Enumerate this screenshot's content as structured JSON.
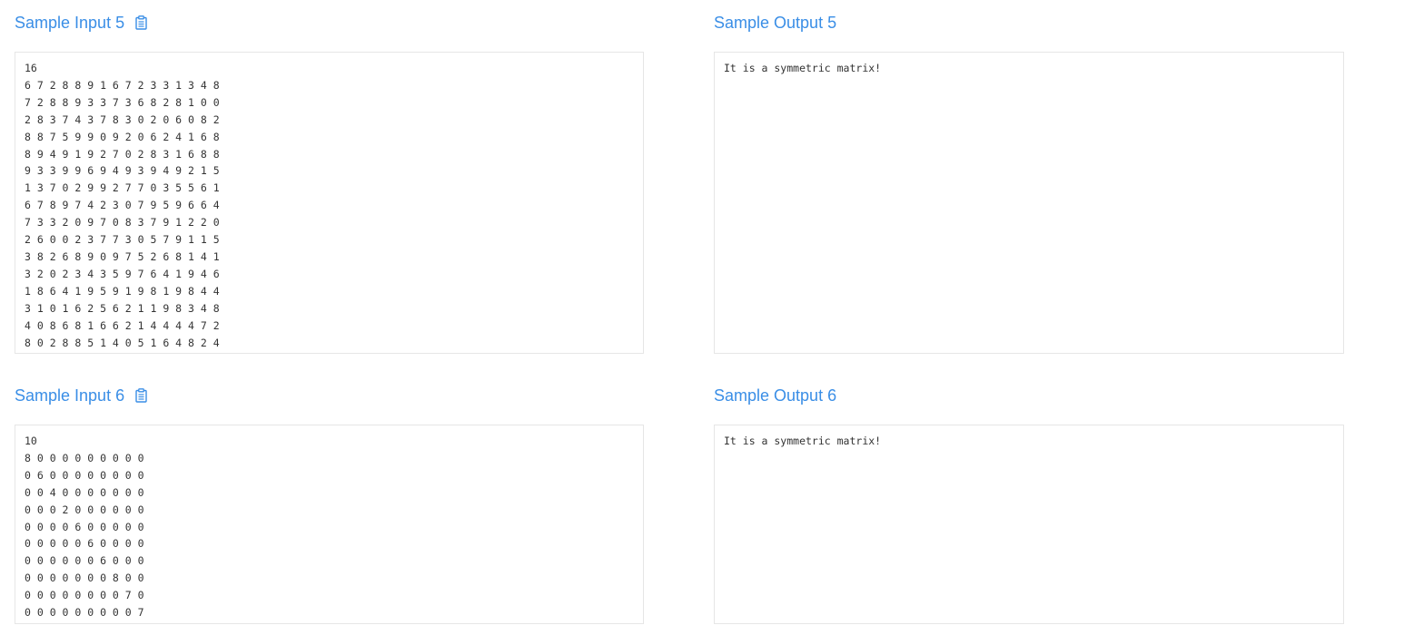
{
  "samples": [
    {
      "input_title": "Sample Input 5",
      "output_title": "Sample Output 5",
      "input_text": "16\n6 7 2 8 8 9 1 6 7 2 3 3 1 3 4 8\n7 2 8 8 9 3 3 7 3 6 8 2 8 1 0 0\n2 8 3 7 4 3 7 8 3 0 2 0 6 0 8 2\n8 8 7 5 9 9 0 9 2 0 6 2 4 1 6 8\n8 9 4 9 1 9 2 7 0 2 8 3 1 6 8 8\n9 3 3 9 9 6 9 4 9 3 9 4 9 2 1 5\n1 3 7 0 2 9 9 2 7 7 0 3 5 5 6 1\n6 7 8 9 7 4 2 3 0 7 9 5 9 6 6 4\n7 3 3 2 0 9 7 0 8 3 7 9 1 2 2 0\n2 6 0 0 2 3 7 7 3 0 5 7 9 1 1 5\n3 8 2 6 8 9 0 9 7 5 2 6 8 1 4 1\n3 2 0 2 3 4 3 5 9 7 6 4 1 9 4 6\n1 8 6 4 1 9 5 9 1 9 8 1 9 8 4 4\n3 1 0 1 6 2 5 6 2 1 1 9 8 3 4 8\n4 0 8 6 8 1 6 6 2 1 4 4 4 4 7 2\n8 0 2 8 8 5 1 4 0 5 1 6 4 8 2 4",
      "output_text": "It is a symmetric matrix!"
    },
    {
      "input_title": "Sample Input 6",
      "output_title": "Sample Output 6",
      "input_text": "10\n8 0 0 0 0 0 0 0 0 0\n0 6 0 0 0 0 0 0 0 0\n0 0 4 0 0 0 0 0 0 0\n0 0 0 2 0 0 0 0 0 0\n0 0 0 0 6 0 0 0 0 0\n0 0 0 0 0 6 0 0 0 0\n0 0 0 0 0 0 6 0 0 0\n0 0 0 0 0 0 0 8 0 0\n0 0 0 0 0 0 0 0 7 0\n0 0 0 0 0 0 0 0 0 7",
      "output_text": "It is a symmetric matrix!"
    }
  ],
  "icons": {
    "copy": "clipboard-icon"
  },
  "colors": {
    "heading": "#3a8ee6",
    "border": "#e6e6e6",
    "text": "#333333"
  }
}
